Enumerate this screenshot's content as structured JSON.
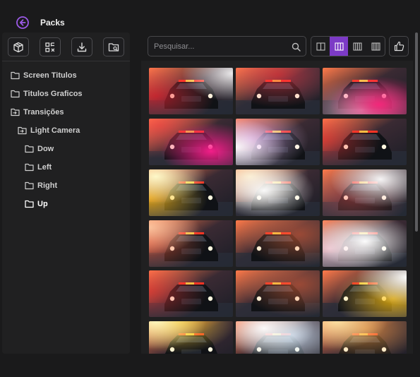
{
  "header": {
    "title": "Packs",
    "back_icon": "arrow-left-circle-icon",
    "accent": "#9b59e6"
  },
  "toolbar": {
    "tools": [
      {
        "name": "packs-cube-button",
        "icon": "cube-icon"
      },
      {
        "name": "scan-qr-button",
        "icon": "qr-scan-icon"
      },
      {
        "name": "download-button",
        "icon": "download-icon"
      },
      {
        "name": "search-folder-button",
        "icon": "folder-search-icon"
      }
    ]
  },
  "tree": [
    {
      "label": "Screen Titulos",
      "level": 0,
      "icon": "folder-icon"
    },
    {
      "label": "Titulos Graficos",
      "level": 0,
      "icon": "folder-icon"
    },
    {
      "label": "Transições",
      "level": 0,
      "icon": "folder-enter-icon"
    },
    {
      "label": "Light Camera",
      "level": 1,
      "icon": "folder-enter-icon"
    },
    {
      "label": "Dow",
      "level": 2,
      "icon": "folder-icon"
    },
    {
      "label": "Left",
      "level": 2,
      "icon": "folder-icon"
    },
    {
      "label": "Right",
      "level": 2,
      "icon": "folder-icon"
    },
    {
      "label": "Up",
      "level": 2,
      "icon": "folder-icon",
      "active": true
    }
  ],
  "search": {
    "placeholder": "Pesquisar...",
    "value": ""
  },
  "view_modes": [
    {
      "name": "view-2-columns",
      "bars": 2,
      "active": false
    },
    {
      "name": "view-3-columns",
      "bars": 3,
      "active": true
    },
    {
      "name": "view-4-columns",
      "bars": 4,
      "active": false
    },
    {
      "name": "view-5-columns",
      "bars": 5,
      "active": false
    }
  ],
  "like_icon": "thumbs-up-icon",
  "thumbnails": [
    {
      "variant": "red-flare-right"
    },
    {
      "variant": "red-flare-center"
    },
    {
      "variant": "white-pink-flare"
    },
    {
      "variant": "pink-orb"
    },
    {
      "variant": "white-flash-left"
    },
    {
      "variant": "red-flare-left"
    },
    {
      "variant": "yellow-burn"
    },
    {
      "variant": "white-burst"
    },
    {
      "variant": "white-orb"
    },
    {
      "variant": "warm-left"
    },
    {
      "variant": "warm-clean"
    },
    {
      "variant": "white-wash"
    },
    {
      "variant": "red-flare-left"
    },
    {
      "variant": "warm-clean"
    },
    {
      "variant": "yellow-flash-right"
    },
    {
      "variant": "yellow-top"
    },
    {
      "variant": "white-bright"
    },
    {
      "variant": "warm-top"
    }
  ]
}
